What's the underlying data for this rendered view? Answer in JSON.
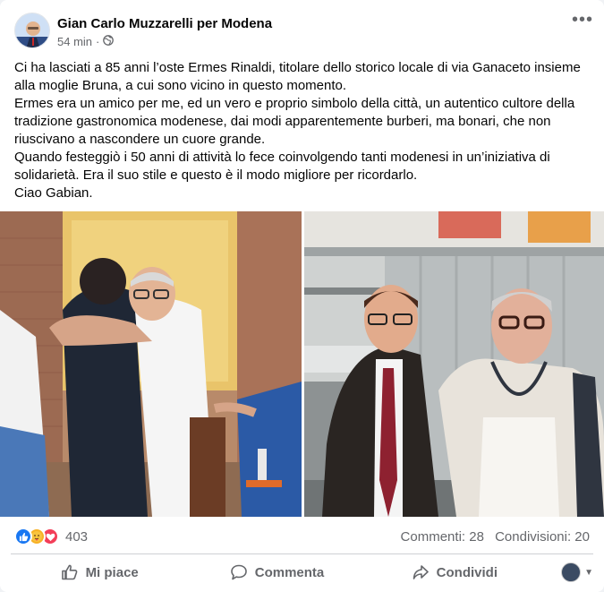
{
  "post": {
    "author": "Gian Carlo Muzzarelli per Modena",
    "time": "54 min",
    "separator": "·",
    "more_icon": "more-horizontal-icon",
    "paragraphs": [
      "Ci ha lasciati a 85 anni l’oste Ermes Rinaldi, titolare dello storico locale di via Ganaceto insieme alla moglie Bruna, a cui sono vicino in questo momento.",
      "Ermes era un amico per me, ed un vero e proprio simbolo della città, un autentico cultore della tradizione gastronomica modenese, dai modi apparentemente burberi, ma bonari, che non riuscivano a nascondere un cuore grande.",
      "Quando festeggiò i 50 anni di attività lo fece coinvolgendo tanti modenesi in un’iniziativa di solidarietà. Era il suo stile e questo è il modo migliore per ricordarlo.",
      "Ciao Gabian."
    ]
  },
  "stats": {
    "reaction_count": "403",
    "comments": "Commenti: 28",
    "shares": "Condivisioni: 20",
    "reactions": [
      "like-reaction",
      "care-reaction",
      "love-reaction"
    ]
  },
  "actions": {
    "like": "Mi piace",
    "comment": "Commenta",
    "share": "Condividi"
  },
  "colors": {
    "brand": "#1877f2",
    "secondary_text": "#65676b"
  }
}
